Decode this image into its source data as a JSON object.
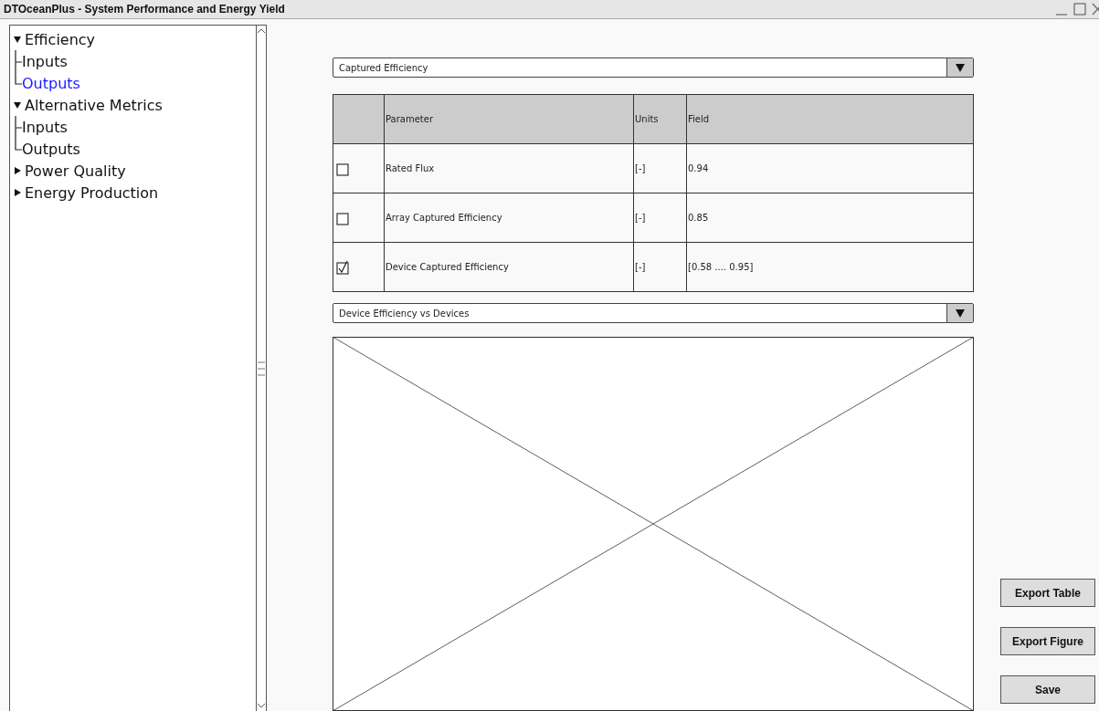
{
  "window": {
    "title": "DTOceanPlus - System Performance and Energy Yield"
  },
  "tree": [
    {
      "label": "Efficiency",
      "expanded": true,
      "children": [
        {
          "label": "Inputs",
          "selected": false
        },
        {
          "label": "Outputs",
          "selected": true
        }
      ]
    },
    {
      "label": "Alternative Metrics",
      "expanded": true,
      "children": [
        {
          "label": "Inputs",
          "selected": false
        },
        {
          "label": "Outputs",
          "selected": false
        }
      ]
    },
    {
      "label": "Power Quality",
      "expanded": false
    },
    {
      "label": "Energy Production",
      "expanded": false
    }
  ],
  "metric_dropdown": {
    "value": "Captured Efficiency"
  },
  "table": {
    "columns": [
      "Parameter",
      "Units",
      "Field"
    ],
    "rows": [
      {
        "checked": false,
        "cells": [
          "Rated Flux",
          "[-]",
          "0.94"
        ]
      },
      {
        "checked": false,
        "cells": [
          "Array Captured Efficiency",
          "[-]",
          "0.85"
        ]
      },
      {
        "checked": true,
        "cells": [
          "Device Captured Efficiency",
          "[-]",
          "[0.58 .... 0.95]"
        ]
      }
    ]
  },
  "figure_dropdown": {
    "value": "Device Efficiency vs Devices"
  },
  "buttons": [
    "Export Table",
    "Export Figure",
    "Save"
  ]
}
